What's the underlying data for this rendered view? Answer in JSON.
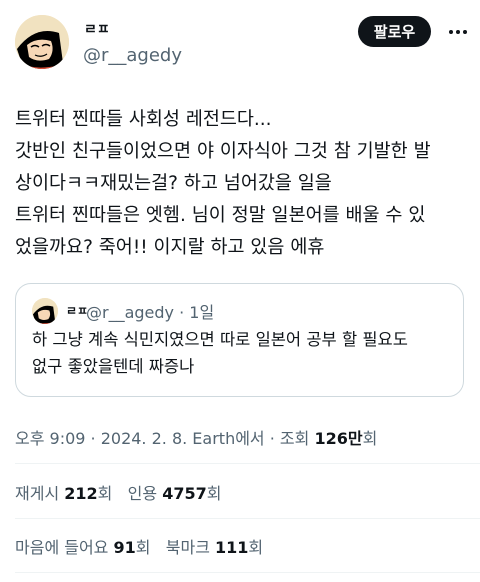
{
  "author": {
    "display_name": "ㄹㅍ",
    "handle": "@r__agedy"
  },
  "follow_label": "팔로우",
  "tweet_lines": [
    "트위터 찐따들 사회성 레전드다...",
    "갓반인 친구들이었으면 야 이자식아 그것 참 기발한 발",
    "상이다ㅋㅋ재밌는걸? 하고 넘어갔을 일을",
    "트위터 찐따들은 엣헴. 님이 정말 일본어를 배울 수 있",
    "었을까요? 죽어!! 이지랄 하고 있음 에휴"
  ],
  "quote": {
    "display_name": "ㄹㅍ",
    "handle_time": "@r__agedy · 1일",
    "lines": [
      "하 그냥 계속 식민지였으면 따로 일본어 공부 할 필요도",
      "없구 좋았을텐데 짜증나"
    ]
  },
  "meta": {
    "datetime_source": "오후 9:09 · 2024. 2. 8. Earth에서 · 조회 ",
    "views_count": "126만",
    "views_suffix": "회"
  },
  "stats": {
    "retweets_label": "재게시 ",
    "retweets_count": "212",
    "retweets_suffix": "회",
    "quotes_label": "인용 ",
    "quotes_count": "4757",
    "quotes_suffix": "회",
    "likes_label": "마음에 들어요 ",
    "likes_count": "91",
    "likes_suffix": "회",
    "bookmarks_label": "북마크 ",
    "bookmarks_count": "111",
    "bookmarks_suffix": "회"
  }
}
